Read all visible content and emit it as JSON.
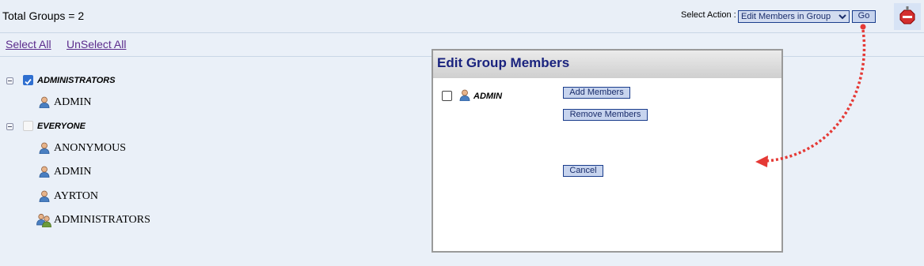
{
  "header": {
    "total_groups": "Total Groups = 2",
    "select_action_label": "Select Action :",
    "action_select_value": "Edit Members in Group",
    "go_label": "Go",
    "stop_icon": "stop-sign-icon"
  },
  "links": {
    "select_all": "Select All",
    "unselect_all": "UnSelect All"
  },
  "tree": {
    "groups": [
      {
        "name": "ADMINISTRATORS",
        "checked": true,
        "members": [
          {
            "name": "ADMIN",
            "icon": "user-icon"
          }
        ]
      },
      {
        "name": "EVERYONE",
        "checked": false,
        "members": [
          {
            "name": "ANONYMOUS",
            "icon": "user-icon"
          },
          {
            "name": "ADMIN",
            "icon": "user-icon"
          },
          {
            "name": "AYRTON",
            "icon": "user-icon"
          },
          {
            "name": "ADMINISTRATORS",
            "icon": "group-icon"
          }
        ]
      }
    ]
  },
  "modal": {
    "title": "Edit Group Members",
    "member_name": "ADMIN",
    "add_members": "Add Members",
    "remove_members": "Remove Members",
    "cancel": "Cancel"
  },
  "colors": {
    "page_bg": "#eaf0f8",
    "link": "#5b2b8c",
    "button_bg": "#c7d4ee",
    "modal_title": "#1a237e",
    "annotation_arrow": "#e53935"
  }
}
